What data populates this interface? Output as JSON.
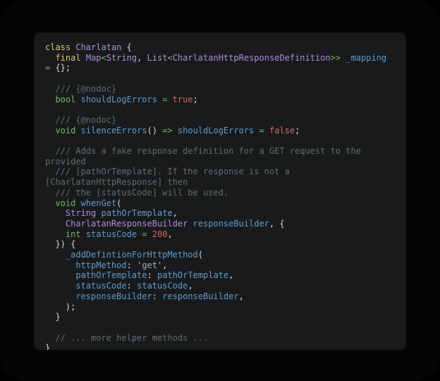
{
  "window": {
    "background_color": "#050505",
    "card_background_color": "#191a1c",
    "card_corner_radius": "9px"
  },
  "editor": {
    "language": "dart",
    "theme": "dark",
    "font_size_px": 12,
    "line_height_px": 14.7,
    "palette": {
      "keyword": "#d7cb6b",
      "type": "#b08fd8",
      "builtin_type": "#72b95f",
      "identifier": "#5e9ccc",
      "number": "#cf6a5b",
      "string": "#9fb4c4",
      "comment": "#606d6d",
      "punctuation": "#d8d8d8",
      "background": "#191a1c"
    }
  },
  "code": {
    "lines": [
      {
        "id": "line-1",
        "tokens": [
          {
            "t": "class",
            "c": "kw"
          },
          {
            "t": " ",
            "c": "pun"
          },
          {
            "t": "Charlatan",
            "c": "typ"
          },
          {
            "t": " {",
            "c": "pun"
          }
        ]
      },
      {
        "id": "line-2",
        "tokens": [
          {
            "t": "  ",
            "c": "pun"
          },
          {
            "t": "final",
            "c": "kw"
          },
          {
            "t": " ",
            "c": "pun"
          },
          {
            "t": "Map",
            "c": "typ"
          },
          {
            "t": "<",
            "c": "gre"
          },
          {
            "t": "String",
            "c": "typ"
          },
          {
            "t": ", ",
            "c": "pun"
          },
          {
            "t": "List",
            "c": "typ"
          },
          {
            "t": "<",
            "c": "gre"
          },
          {
            "t": "CharlatanHttpResponseDefinition",
            "c": "typ"
          },
          {
            "t": ">>",
            "c": "gre"
          },
          {
            "t": " ",
            "c": "pun"
          },
          {
            "t": "_mapping",
            "c": "idn"
          },
          {
            "t": " ",
            "c": "pun"
          },
          {
            "t": "=",
            "c": "gre"
          },
          {
            "t": " {};",
            "c": "pun"
          }
        ]
      },
      {
        "id": "line-3",
        "blank": true,
        "tokens": []
      },
      {
        "id": "line-4",
        "tokens": [
          {
            "t": "  /// {@nodoc}",
            "c": "cmt"
          }
        ]
      },
      {
        "id": "line-5",
        "tokens": [
          {
            "t": "  ",
            "c": "pun"
          },
          {
            "t": "bool",
            "c": "gre"
          },
          {
            "t": " ",
            "c": "pun"
          },
          {
            "t": "shouldLogErrors",
            "c": "idn"
          },
          {
            "t": " ",
            "c": "pun"
          },
          {
            "t": "=",
            "c": "gre"
          },
          {
            "t": " ",
            "c": "pun"
          },
          {
            "t": "true",
            "c": "num"
          },
          {
            "t": ";",
            "c": "pun"
          }
        ]
      },
      {
        "id": "line-6",
        "blank": true,
        "tokens": []
      },
      {
        "id": "line-7",
        "tokens": [
          {
            "t": "  /// {@nodoc}",
            "c": "cmt"
          }
        ]
      },
      {
        "id": "line-8",
        "tokens": [
          {
            "t": "  ",
            "c": "pun"
          },
          {
            "t": "void",
            "c": "gre"
          },
          {
            "t": " ",
            "c": "pun"
          },
          {
            "t": "silenceErrors",
            "c": "idn"
          },
          {
            "t": "()",
            "c": "pun"
          },
          {
            "t": " ",
            "c": "pun"
          },
          {
            "t": "=>",
            "c": "gre"
          },
          {
            "t": " ",
            "c": "pun"
          },
          {
            "t": "shouldLogErrors",
            "c": "idn"
          },
          {
            "t": " ",
            "c": "pun"
          },
          {
            "t": "=",
            "c": "gre"
          },
          {
            "t": " ",
            "c": "pun"
          },
          {
            "t": "false",
            "c": "num"
          },
          {
            "t": ";",
            "c": "pun"
          }
        ]
      },
      {
        "id": "line-9",
        "blank": true,
        "tokens": []
      },
      {
        "id": "line-10",
        "tokens": [
          {
            "t": "  /// Adds a fake response definition for a GET request to the provided",
            "c": "cmt"
          }
        ]
      },
      {
        "id": "line-11",
        "tokens": [
          {
            "t": "  /// [pathOrTemplate]. If the response is not a [CharlatanHttpResponse] then",
            "c": "cmt"
          }
        ]
      },
      {
        "id": "line-12",
        "tokens": [
          {
            "t": "  /// the [statusCode] will be used.",
            "c": "cmt"
          }
        ]
      },
      {
        "id": "line-13",
        "tokens": [
          {
            "t": "  ",
            "c": "pun"
          },
          {
            "t": "void",
            "c": "gre"
          },
          {
            "t": " ",
            "c": "pun"
          },
          {
            "t": "whenGet",
            "c": "idn"
          },
          {
            "t": "(",
            "c": "pun"
          }
        ]
      },
      {
        "id": "line-14",
        "tokens": [
          {
            "t": "    ",
            "c": "pun"
          },
          {
            "t": "String",
            "c": "typ"
          },
          {
            "t": " ",
            "c": "pun"
          },
          {
            "t": "pathOrTemplate",
            "c": "idn"
          },
          {
            "t": ",",
            "c": "pun"
          }
        ]
      },
      {
        "id": "line-15",
        "tokens": [
          {
            "t": "    ",
            "c": "pun"
          },
          {
            "t": "CharlatanResponseBuilder",
            "c": "typ"
          },
          {
            "t": " ",
            "c": "pun"
          },
          {
            "t": "responseBuilder",
            "c": "idn"
          },
          {
            "t": ", {",
            "c": "pun"
          }
        ]
      },
      {
        "id": "line-16",
        "tokens": [
          {
            "t": "    ",
            "c": "pun"
          },
          {
            "t": "int",
            "c": "gre"
          },
          {
            "t": " ",
            "c": "pun"
          },
          {
            "t": "statusCode",
            "c": "idn"
          },
          {
            "t": " ",
            "c": "pun"
          },
          {
            "t": "=",
            "c": "gre"
          },
          {
            "t": " ",
            "c": "pun"
          },
          {
            "t": "200",
            "c": "num"
          },
          {
            "t": ",",
            "c": "pun"
          }
        ]
      },
      {
        "id": "line-17",
        "tokens": [
          {
            "t": "  }) {",
            "c": "pun"
          }
        ]
      },
      {
        "id": "line-18",
        "tokens": [
          {
            "t": "    ",
            "c": "pun"
          },
          {
            "t": "_addDefintionForHttpMethod",
            "c": "idn"
          },
          {
            "t": "(",
            "c": "pun"
          }
        ]
      },
      {
        "id": "line-19",
        "tokens": [
          {
            "t": "      ",
            "c": "pun"
          },
          {
            "t": "httpMethod",
            "c": "idn"
          },
          {
            "t": ": ",
            "c": "pun"
          },
          {
            "t": "'get'",
            "c": "str"
          },
          {
            "t": ",",
            "c": "pun"
          }
        ]
      },
      {
        "id": "line-20",
        "tokens": [
          {
            "t": "      ",
            "c": "pun"
          },
          {
            "t": "pathOrTemplate",
            "c": "idn"
          },
          {
            "t": ": ",
            "c": "pun"
          },
          {
            "t": "pathOrTemplate",
            "c": "idn"
          },
          {
            "t": ",",
            "c": "pun"
          }
        ]
      },
      {
        "id": "line-21",
        "tokens": [
          {
            "t": "      ",
            "c": "pun"
          },
          {
            "t": "statusCode",
            "c": "idn"
          },
          {
            "t": ": ",
            "c": "pun"
          },
          {
            "t": "statusCode",
            "c": "idn"
          },
          {
            "t": ",",
            "c": "pun"
          }
        ]
      },
      {
        "id": "line-22",
        "tokens": [
          {
            "t": "      ",
            "c": "pun"
          },
          {
            "t": "responseBuilder",
            "c": "idn"
          },
          {
            "t": ": ",
            "c": "pun"
          },
          {
            "t": "responseBuilder",
            "c": "idn"
          },
          {
            "t": ",",
            "c": "pun"
          }
        ]
      },
      {
        "id": "line-23",
        "tokens": [
          {
            "t": "    );",
            "c": "pun"
          }
        ]
      },
      {
        "id": "line-24",
        "tokens": [
          {
            "t": "  }",
            "c": "pun"
          }
        ]
      },
      {
        "id": "line-25",
        "blank": true,
        "tokens": []
      },
      {
        "id": "line-26",
        "tokens": [
          {
            "t": "  // ... more helper methods ...",
            "c": "cmt"
          }
        ]
      },
      {
        "id": "line-27",
        "tokens": [
          {
            "t": "}",
            "c": "pun"
          }
        ]
      }
    ]
  }
}
